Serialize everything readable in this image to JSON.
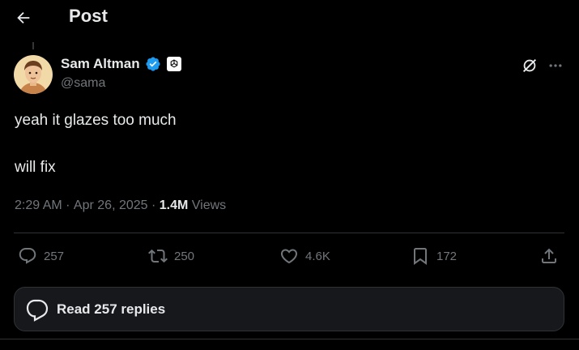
{
  "header": {
    "title": "Post"
  },
  "author": {
    "name": "Sam Altman",
    "handle": "@sama"
  },
  "tweet": {
    "lines": [
      "yeah it glazes too much",
      "will fix"
    ]
  },
  "meta": {
    "time": "2:29 AM",
    "separator": " · ",
    "date": "Apr 26, 2025",
    "views_count": "1.4M",
    "views_label": " Views"
  },
  "actions": {
    "replies": "257",
    "reposts": "250",
    "likes": "4.6K",
    "bookmarks": "172"
  },
  "read_replies": {
    "label": "Read 257 replies"
  },
  "colors": {
    "background": "#000000",
    "text": "#e7e9ea",
    "muted": "#71767b",
    "verified": "#1d9bf0",
    "border": "#2f3336"
  },
  "icons": {
    "back": "arrow-left-icon",
    "verified": "verified-badge-icon",
    "affiliation": "openai-logo-icon",
    "grok": "grok-icon",
    "more": "more-dots-icon",
    "reply": "reply-icon",
    "repost": "repost-icon",
    "like": "heart-icon",
    "bookmark": "bookmark-icon",
    "share": "share-icon"
  }
}
